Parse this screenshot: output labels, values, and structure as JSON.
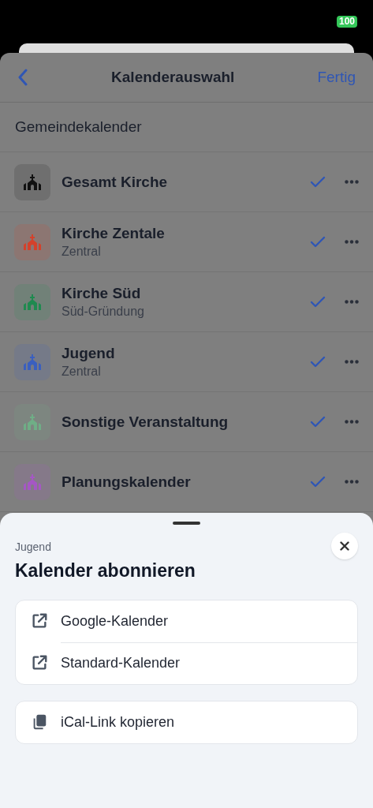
{
  "status_bar": {
    "battery": "100"
  },
  "nav": {
    "title": "Kalenderauswahl",
    "done": "Fertig"
  },
  "section": {
    "title": "Gemeindekalender"
  },
  "calendars": [
    {
      "name": "Gesamt Kirche",
      "color": "#111111",
      "checked": true
    },
    {
      "name": "Kirche Zentale",
      "subtitle": "Zentral",
      "color": "#d4412b",
      "checked": true
    },
    {
      "name": "Kirche Süd",
      "subtitle": "Süd-Gründung",
      "color": "#1f8a4f",
      "checked": true
    },
    {
      "name": "Jugend",
      "subtitle": "Zentral",
      "color": "#3a5fbf",
      "checked": true
    },
    {
      "name": "Sonstige Veranstaltung",
      "color": "#6fae86",
      "checked": true
    },
    {
      "name": "Planungskalender",
      "color": "#a557c4",
      "checked": true
    }
  ],
  "sheet": {
    "subtitle": "Jugend",
    "title": "Kalender abonnieren",
    "groups": [
      [
        {
          "label": "Google-Kalender",
          "kind": "external"
        },
        {
          "label": "Standard-Kalender",
          "kind": "external"
        }
      ],
      [
        {
          "label": "iCal-Link kopieren",
          "kind": "copy"
        }
      ]
    ]
  }
}
